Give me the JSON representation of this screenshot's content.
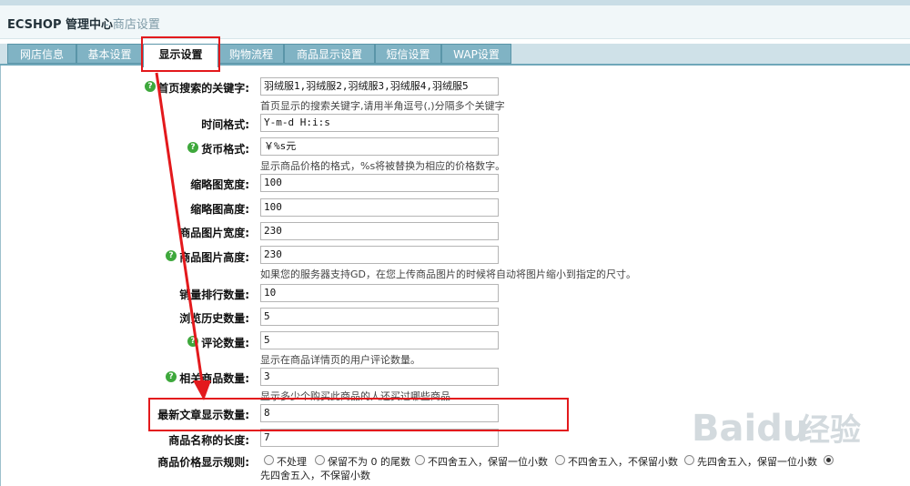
{
  "header": {
    "title": "ECSHOP 管理中心",
    "subtitle": "- 商店设置"
  },
  "tabs": [
    "网店信息",
    "基本设置",
    "显示设置",
    "购物流程",
    "商品显示设置",
    "短信设置",
    "WAP设置"
  ],
  "fields": {
    "search_keywords": {
      "label": "首页搜索的关键字:",
      "value": "羽绒服1,羽绒服2,羽绒服3,羽绒服4,羽绒服5",
      "hint": "首页显示的搜索关键字,请用半角逗号(,)分隔多个关键字"
    },
    "time_format": {
      "label": "时间格式:",
      "value": "Y-m-d H:i:s"
    },
    "currency_format": {
      "label": "货币格式:",
      "value": "￥%s元",
      "hint": "显示商品价格的格式，%s将被替换为相应的价格数字。"
    },
    "thumb_width": {
      "label": "缩略图宽度:",
      "value": "100"
    },
    "thumb_height": {
      "label": "缩略图高度:",
      "value": "100"
    },
    "image_width": {
      "label": "商品图片宽度:",
      "value": "230"
    },
    "image_height": {
      "label": "商品图片高度:",
      "value": "230",
      "hint": "如果您的服务器支持GD，在您上传商品图片的时候将自动将图片缩小到指定的尺寸。"
    },
    "top_sales": {
      "label": "销量排行数量:",
      "value": "10"
    },
    "history": {
      "label": "浏览历史数量:",
      "value": "5"
    },
    "comments": {
      "label": "评论数量:",
      "value": "5",
      "hint": "显示在商品详情页的用户评论数量。"
    },
    "related": {
      "label": "相关商品数量:",
      "value": "3",
      "hint": "显示多少个购买此商品的人还买过哪些商品"
    },
    "articles": {
      "label": "最新文章显示数量:",
      "value": "8"
    },
    "name_length": {
      "label": "商品名称的长度:",
      "value": "7"
    },
    "price_rule": {
      "label": "商品价格显示规则:",
      "options": [
        "不处理",
        "保留不为 0 的尾数",
        "不四舍五入，保留一位小数",
        "不四舍五入，不保留小数",
        "先四舍五入，保留一位小数",
        "先四舍五入，不保留小数"
      ],
      "selected": 5
    }
  },
  "watermark": "Baidu经验",
  "colors": {
    "highlight": "#e3191c",
    "tab_bg": "#80b3c4",
    "help_icon": "#3ea83c"
  }
}
